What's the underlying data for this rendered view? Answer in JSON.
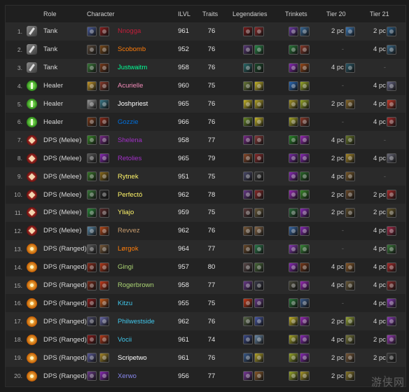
{
  "headers": {
    "role": "Role",
    "character": "Character",
    "ilvl": "ILVL",
    "traits": "Traits",
    "legendaries": "Legendaries",
    "trinkets": "Trinkets",
    "tier20": "Tier 20",
    "tier21": "Tier 21"
  },
  "watermark": "游侠网",
  "colors": {
    "warrior": "#c79c6e",
    "monk": "#00ff96",
    "druid": "#ff7d0a",
    "priest": "#ffffff",
    "shaman": "#0070de",
    "deathknight": "#c41e3a",
    "demonhunter": "#a330c9",
    "paladin": "#f58cba",
    "rogue": "#fff569",
    "hunter": "#abd473",
    "mage": "#40c7eb",
    "warlock": "#8787ed",
    "nnogga": "#c41e3a"
  },
  "rows": [
    {
      "num": "1.",
      "role": "Tank",
      "role_icon": "tank",
      "name": "Nnogga",
      "color": "#c41e3a",
      "spec_icon": "blood-spec-icon",
      "spec_bg": "#4b5ea0",
      "cls_bg": "#8c1f1f",
      "ilvl": "961",
      "traits": "76",
      "leg": [
        "#7a1c1c",
        "#8d2a2a"
      ],
      "trk": [
        "#6d3aa8",
        "#3a6b9a"
      ],
      "t20c": "2 pc",
      "t20i": "#3c7ab8",
      "t21c": "2 pc",
      "t21i": "#2a5f8a"
    },
    {
      "num": "2.",
      "role": "Tank",
      "role_icon": "tank",
      "name": "Scobomb",
      "color": "#ff7d0a",
      "spec_icon": "guardian-spec-icon",
      "spec_bg": "#5a4a3a",
      "cls_bg": "#7a4a1a",
      "ilvl": "952",
      "traits": "76",
      "leg": [
        "#5a3a7a",
        "#2a8a4a"
      ],
      "trk": [
        "#2a7a3a",
        "#8a3a2a"
      ],
      "t20c": "-",
      "t20i": "",
      "t21c": "4 pc",
      "t21i": "#3a6a8a"
    },
    {
      "num": "3.",
      "role": "Tank",
      "role_icon": "tank",
      "name": "Justwaitm",
      "color": "#00ff96",
      "spec_icon": "brewmaster-spec-icon",
      "spec_bg": "#3a7a3a",
      "cls_bg": "#7a3a1a",
      "ilvl": "958",
      "traits": "76",
      "leg": [
        "#2a6a6a",
        "#1a4a2a"
      ],
      "trk": [
        "#8a2ab8",
        "#9a4a1a"
      ],
      "t20c": "4 pc",
      "t20i": "#2a5a6a",
      "t21c": "-",
      "t21i": ""
    },
    {
      "num": "4.",
      "role": "Healer",
      "role_icon": "healer",
      "name": "Acurielle",
      "color": "#f58cba",
      "spec_icon": "holy-paladin-spec-icon",
      "spec_bg": "#c89a2a",
      "cls_bg": "#8a3a2a",
      "ilvl": "960",
      "traits": "75",
      "leg": [
        "#6a7a3a",
        "#c8b82a"
      ],
      "trk": [
        "#2a6ab8",
        "#9aaa2a"
      ],
      "t20c": "-",
      "t20i": "",
      "t21c": "4 pc",
      "t21i": "#6a6a8a"
    },
    {
      "num": "5.",
      "role": "Healer",
      "role_icon": "healer",
      "name": "Joshpriest",
      "color": "#ffffff",
      "spec_icon": "holy-priest-spec-icon",
      "spec_bg": "#9a9a9a",
      "cls_bg": "#3a7a8a",
      "ilvl": "965",
      "traits": "76",
      "leg": [
        "#c8b82a",
        "#b8a82a"
      ],
      "trk": [
        "#aa9a2a",
        "#9aaa2a"
      ],
      "t20c": "2 pc",
      "t20i": "#8a6a2a",
      "t21c": "4 pc",
      "t21i": "#c83a2a"
    },
    {
      "num": "6.",
      "role": "Healer",
      "role_icon": "healer",
      "name": "Gozzie",
      "color": "#0070de",
      "spec_icon": "resto-shaman-spec-icon",
      "spec_bg": "#7a3a1a",
      "cls_bg": "#8a2a1a",
      "ilvl": "966",
      "traits": "76",
      "leg": [
        "#6a8a2a",
        "#c8b82a"
      ],
      "trk": [
        "#aaaa2a",
        "#8a3a2a"
      ],
      "t20c": "-",
      "t20i": "",
      "t21c": "4 pc",
      "t21i": "#aa2a2a"
    },
    {
      "num": "7.",
      "role": "DPS (Melee)",
      "role_icon": "melee",
      "name": "Shelena",
      "color": "#a330c9",
      "spec_icon": "havoc-spec-icon",
      "spec_bg": "#3a8a2a",
      "cls_bg": "#7a2a8a",
      "ilvl": "958",
      "traits": "77",
      "leg": [
        "#7a2a8a",
        "#8a3a3a"
      ],
      "trk": [
        "#2a8a2a",
        "#9a2ab8"
      ],
      "t20c": "4 pc",
      "t20i": "#6a7a2a",
      "t21c": "-",
      "t21i": ""
    },
    {
      "num": "8.",
      "role": "DPS (Melee)",
      "role_icon": "melee",
      "name": "Retolies",
      "color": "#a330c9",
      "spec_icon": "havoc-spec-icon",
      "spec_bg": "#5a5a5a",
      "cls_bg": "#8a2ab8",
      "ilvl": "965",
      "traits": "79",
      "leg": [
        "#8a4a2a",
        "#8a2a2a"
      ],
      "trk": [
        "#7a2aa8",
        "#8a2ab8"
      ],
      "t20c": "2 pc",
      "t20i": "#aa8a2a",
      "t21c": "4 pc",
      "t21i": "#6a6a7a"
    },
    {
      "num": "9.",
      "role": "DPS (Melee)",
      "role_icon": "melee",
      "name": "Rytnek",
      "color": "#fff569",
      "spec_icon": "rogue-spec-icon",
      "spec_bg": "#3a7a2a",
      "cls_bg": "#8a6a1a",
      "ilvl": "951",
      "traits": "75",
      "leg": [
        "#4a4a6a",
        "#3a3a3a"
      ],
      "trk": [
        "#8a2ab8",
        "#2a6a2a"
      ],
      "t20c": "4 pc",
      "t20i": "#7a5a2a",
      "t21c": "-",
      "t21i": ""
    },
    {
      "num": "10.",
      "role": "DPS (Melee)",
      "role_icon": "melee",
      "name": "Perfectó",
      "color": "#fff569",
      "spec_icon": "rogue-spec-icon",
      "spec_bg": "#3a7a3a",
      "cls_bg": "#2a2a2a",
      "ilvl": "962",
      "traits": "78",
      "leg": [
        "#6a3a8a",
        "#8a2a2a"
      ],
      "trk": [
        "#9a2ab8",
        "#3a8a2a"
      ],
      "t20c": "2 pc",
      "t20i": "#6a4a2a",
      "t21c": "2 pc",
      "t21i": "#aa2a2a"
    },
    {
      "num": "11.",
      "role": "DPS (Melee)",
      "role_icon": "melee",
      "name": "Yliajo",
      "color": "#fff569",
      "spec_icon": "rogue-spec-icon",
      "spec_bg": "#2a8a3a",
      "cls_bg": "#5a2a2a",
      "ilvl": "959",
      "traits": "75",
      "leg": [
        "#5a3a3a",
        "#6a5a3a"
      ],
      "trk": [
        "#2a6a3a",
        "#8a2ab8"
      ],
      "t20c": "2 pc",
      "t20i": "#5a4a2a",
      "t21c": "2 pc",
      "t21i": "#6a5a2a"
    },
    {
      "num": "12.",
      "role": "DPS (Melee)",
      "role_icon": "melee",
      "name": "Revvez",
      "color": "#c79c6e",
      "spec_icon": "warrior-spec-icon",
      "spec_bg": "#5a8aaa",
      "cls_bg": "#b84a1a",
      "ilvl": "962",
      "traits": "76",
      "leg": [
        "#7a5a3a",
        "#8a6a4a"
      ],
      "trk": [
        "#3a6aa8",
        "#8a2ab8"
      ],
      "t20c": "-",
      "t20i": "",
      "t21c": "4 pc",
      "t21i": "#aa2a4a"
    },
    {
      "num": "13.",
      "role": "DPS (Ranged)",
      "role_icon": "ranged",
      "name": "Lørgok",
      "color": "#ff7d0a",
      "spec_icon": "balance-spec-icon",
      "spec_bg": "#5a5a5a",
      "cls_bg": "#7a5a3a",
      "ilvl": "964",
      "traits": "77",
      "leg": [
        "#6a4a2a",
        "#2a7a4a"
      ],
      "trk": [
        "#8a3ab8",
        "#3a8a3a"
      ],
      "t20c": "-",
      "t20i": "",
      "t21c": "4 pc",
      "t21i": "#3a7a3a"
    },
    {
      "num": "14.",
      "role": "DPS (Ranged)",
      "role_icon": "ranged",
      "name": "Gingi",
      "color": "#abd473",
      "spec_icon": "hunter-spec-icon",
      "spec_bg": "#8a2a1a",
      "cls_bg": "#b83a1a",
      "ilvl": "957",
      "traits": "80",
      "leg": [
        "#5a4a4a",
        "#4a6a3a"
      ],
      "trk": [
        "#8a2ab8",
        "#7a3a1a"
      ],
      "t20c": "4 pc",
      "t20i": "#8a5a2a",
      "t21c": "4 pc",
      "t21i": "#aa2a2a"
    },
    {
      "num": "15.",
      "role": "DPS (Ranged)",
      "role_icon": "ranged",
      "name": "Rogerbrown",
      "color": "#abd473",
      "spec_icon": "hunter-spec-icon",
      "spec_bg": "#7a2a1a",
      "cls_bg": "#c83a1a",
      "ilvl": "958",
      "traits": "77",
      "leg": [
        "#6a3a8a",
        "#3a3a4a"
      ],
      "trk": [
        "#4a4a3a",
        "#9a2ab8"
      ],
      "t20c": "4 pc",
      "t20i": "#6a5a3a",
      "t21c": "4 pc",
      "t21i": "#8a2a2a"
    },
    {
      "num": "16.",
      "role": "DPS (Ranged)",
      "role_icon": "ranged",
      "name": "Kitzu",
      "color": "#40c7eb",
      "spec_icon": "mage-spec-icon",
      "spec_bg": "#8a1a1a",
      "cls_bg": "#c85a1a",
      "ilvl": "955",
      "traits": "75",
      "leg": [
        "#c83a1a",
        "#6a3a8a"
      ],
      "trk": [
        "#2a7a3a",
        "#3a5a8a"
      ],
      "t20c": "-",
      "t20i": "",
      "t21c": "4 pc",
      "t21i": "#8a3ab8"
    },
    {
      "num": "17.",
      "role": "DPS (Ranged)",
      "role_icon": "ranged",
      "name": "Philwestside",
      "color": "#40c7eb",
      "spec_icon": "mage-spec-icon",
      "spec_bg": "#4a4a6a",
      "cls_bg": "#6a6aaa",
      "ilvl": "962",
      "traits": "76",
      "leg": [
        "#5a6a4a",
        "#4a5aa8"
      ],
      "trk": [
        "#c8b82a",
        "#9a2ab8"
      ],
      "t20c": "2 pc",
      "t20i": "#9aaa3a",
      "t21c": "4 pc",
      "t21i": "#8a3ab8"
    },
    {
      "num": "18.",
      "role": "DPS (Ranged)",
      "role_icon": "ranged",
      "name": "Vocii",
      "color": "#40c7eb",
      "spec_icon": "mage-spec-icon",
      "spec_bg": "#8a1a1a",
      "cls_bg": "#b83a1a",
      "ilvl": "961",
      "traits": "74",
      "leg": [
        "#3a4a8a",
        "#6a8aaa"
      ],
      "trk": [
        "#aaaa2a",
        "#8a2ab8"
      ],
      "t20c": "4 pc",
      "t20i": "#7a7a3a",
      "t21c": "2 pc",
      "t21i": "#9a3ab8"
    },
    {
      "num": "19.",
      "role": "DPS (Ranged)",
      "role_icon": "ranged",
      "name": "Scripetwo",
      "color": "#ffffff",
      "spec_icon": "shadow-spec-icon",
      "spec_bg": "#5a5a9a",
      "cls_bg": "#aa8a2a",
      "ilvl": "961",
      "traits": "76",
      "leg": [
        "#3a5a8a",
        "#b8a82a"
      ],
      "trk": [
        "#9aaa2a",
        "#8a2ab8"
      ],
      "t20c": "2 pc",
      "t20i": "#7a5a3a",
      "t21c": "2 pc",
      "t21i": "#3a3a3a"
    },
    {
      "num": "20.",
      "role": "DPS (Ranged)",
      "role_icon": "ranged",
      "name": "Xerwo",
      "color": "#8787ed",
      "spec_icon": "warlock-spec-icon",
      "spec_bg": "#6a3a8a",
      "cls_bg": "#8a2ab8",
      "ilvl": "956",
      "traits": "77",
      "leg": [
        "#7a3a9a",
        "#8a5a2a"
      ],
      "trk": [
        "#9aaa2a",
        "#aa9a2a"
      ],
      "t20c": "2 pc",
      "t20i": "#8a7a2a",
      "t21c": "-",
      "t21i": ""
    }
  ]
}
